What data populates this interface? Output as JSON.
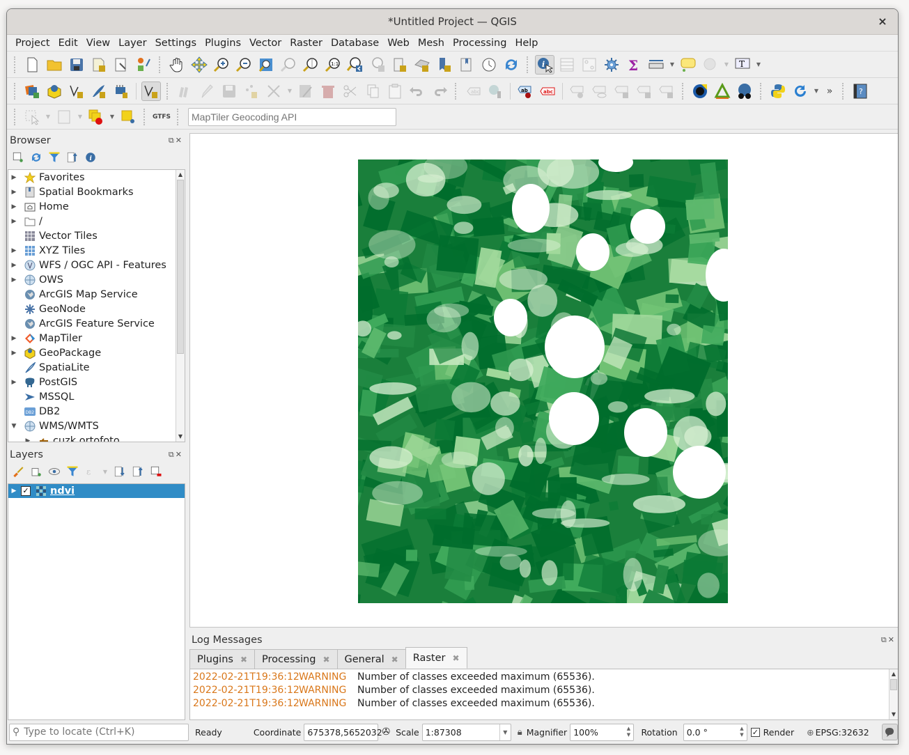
{
  "window": {
    "title": "*Untitled Project — QGIS",
    "close_label": "×"
  },
  "menu": [
    "Project",
    "Edit",
    "View",
    "Layer",
    "Settings",
    "Plugins",
    "Vector",
    "Raster",
    "Database",
    "Web",
    "Mesh",
    "Processing",
    "Help"
  ],
  "toolbar1": [
    "new-project",
    "open-project",
    "save-project",
    "new-print-layout",
    "layout-manager",
    "style-manager",
    "pan",
    "pan-to-selection",
    "zoom-in",
    "zoom-out",
    "zoom-full",
    "zoom-to-selection",
    "zoom-to-layer",
    "zoom-native",
    "zoom-last",
    "zoom-next",
    "new-map-view",
    "new-3d-map-view",
    "new-bookmark",
    "show-bookmarks",
    "temporal-controller",
    "refresh",
    "identify-features",
    "attribute-table",
    "field-calculator-disabled",
    "processing-toolbox",
    "statistical-summary",
    "measure-line",
    "map-tips",
    "actions",
    "text-annotation"
  ],
  "toolbar2": [
    "data-source-manager",
    "new-geopackage-layer",
    "new-shapefile-layer",
    "new-spatialite-layer",
    "new-virtual-layer",
    "new-temporary-scratch-layer",
    "current-edits",
    "toggle-editing",
    "save-layer-edits",
    "add-point-feature",
    "vertex-tool",
    "modify-attributes",
    "delete-selected",
    "cut-features",
    "copy-features",
    "paste-features",
    "undo",
    "redo",
    "label-toolbar",
    "layer-diagram",
    "layer-labeling",
    "layer-labeling-rule",
    "pin-labels",
    "show-hide-labels",
    "move-label",
    "rotate-label",
    "change-label",
    "qfield-sync",
    "triangle-plugin",
    "metasearch",
    "python-console",
    "plugin-reloader",
    "more-tools",
    "help-contents"
  ],
  "toolbar3": {
    "search_placeholder": "MapTiler Geocoding API",
    "gtfs_label": "GTFS"
  },
  "browser": {
    "title": "Browser",
    "items": [
      {
        "label": "Favorites",
        "icon": "star-icon",
        "expandable": true
      },
      {
        "label": "Spatial Bookmarks",
        "icon": "bookmark-icon",
        "expandable": true
      },
      {
        "label": "Home",
        "icon": "home-folder-icon",
        "expandable": true
      },
      {
        "label": "/",
        "icon": "folder-icon",
        "expandable": true
      },
      {
        "label": "Vector Tiles",
        "icon": "grid-icon",
        "expandable": false
      },
      {
        "label": "XYZ Tiles",
        "icon": "tiles-icon",
        "expandable": true
      },
      {
        "label": "WFS / OGC API - Features",
        "icon": "wfs-icon",
        "expandable": true
      },
      {
        "label": "OWS",
        "icon": "globe-icon",
        "expandable": true
      },
      {
        "label": "ArcGIS Map Service",
        "icon": "arcgis-icon",
        "expandable": false
      },
      {
        "label": "GeoNode",
        "icon": "geonode-icon",
        "expandable": false
      },
      {
        "label": "ArcGIS Feature Service",
        "icon": "arcgis-icon",
        "expandable": false
      },
      {
        "label": "MapTiler",
        "icon": "maptiler-icon",
        "expandable": true
      },
      {
        "label": "GeoPackage",
        "icon": "geopackage-icon",
        "expandable": true
      },
      {
        "label": "SpatiaLite",
        "icon": "feather-icon",
        "expandable": false
      },
      {
        "label": "PostGIS",
        "icon": "elephant-icon",
        "expandable": true
      },
      {
        "label": "MSSQL",
        "icon": "mssql-icon",
        "expandable": false
      },
      {
        "label": "DB2",
        "icon": "db2-icon",
        "expandable": false
      },
      {
        "label": "WMS/WMTS",
        "icon": "globe-icon",
        "expandable": true,
        "expanded": true
      },
      {
        "label": "cuzk ortofoto",
        "icon": "wms-connection-icon",
        "expandable": true,
        "child": true
      }
    ]
  },
  "layers": {
    "title": "Layers",
    "items": [
      {
        "label": "ndvi",
        "checked": true,
        "selected": true
      }
    ]
  },
  "log": {
    "title": "Log Messages",
    "tabs": [
      "Plugins",
      "Processing",
      "General",
      "Raster"
    ],
    "active_tab": "Raster",
    "rows": [
      {
        "time": "2022-02-21T19:36:12",
        "level": "WARNING",
        "message": "Number of classes exceeded maximum (65536)."
      },
      {
        "time": "2022-02-21T19:36:12",
        "level": "WARNING",
        "message": "Number of classes exceeded maximum (65536)."
      },
      {
        "time": "2022-02-21T19:36:12",
        "level": "WARNING",
        "message": "Number of classes exceeded maximum (65536)."
      }
    ]
  },
  "status": {
    "locate_placeholder": "Type to locate (Ctrl+K)",
    "ready": "Ready",
    "coordinate_label": "Coordinate",
    "coordinate_value": "675378,5652032",
    "scale_label": "Scale",
    "scale_value": "1:87308",
    "magnifier_label": "Magnifier",
    "magnifier_value": "100%",
    "rotation_label": "Rotation",
    "rotation_value": "0.0 °",
    "render_label": "Render",
    "render_checked": true,
    "crs": "EPSG:32632"
  },
  "colors": {
    "selection": "#308cc6",
    "warning": "#d9771a",
    "ndvi_dark": "#006d2c",
    "ndvi_light": "#c7e9c0"
  }
}
